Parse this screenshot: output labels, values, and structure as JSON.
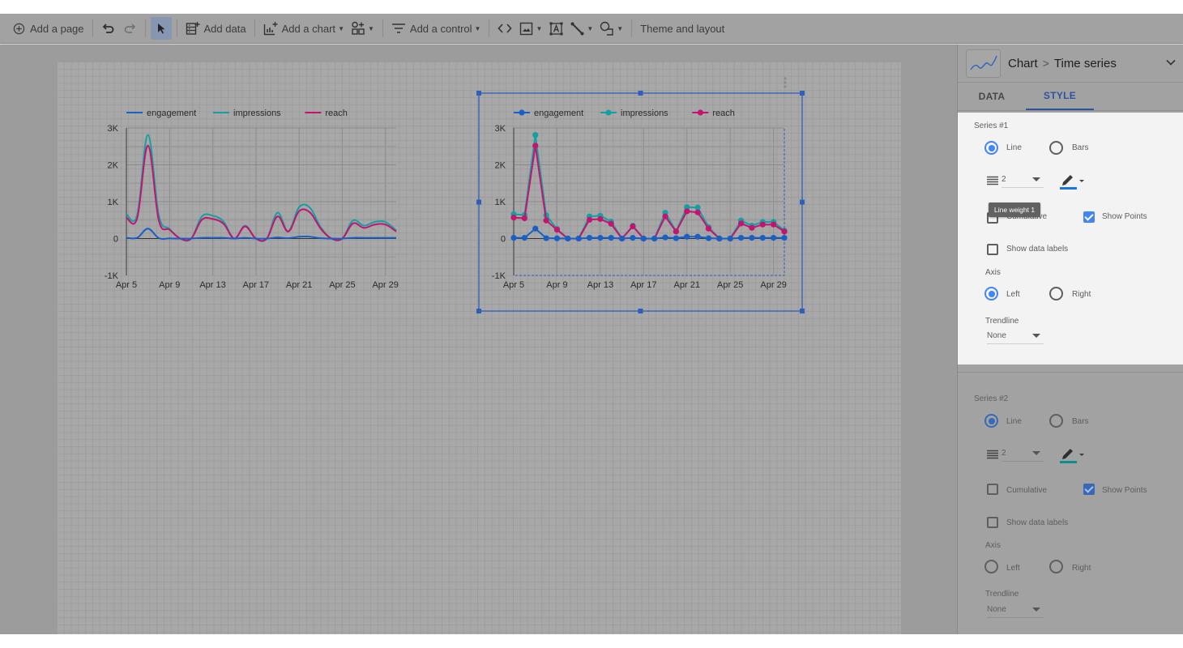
{
  "toolbar": {
    "add_page": "Add a page",
    "add_data": "Add data",
    "add_chart": "Add a chart",
    "add_control": "Add a control",
    "theme_layout": "Theme and layout",
    "icons": [
      "add-circle-icon",
      "undo-icon",
      "redo-icon",
      "select-pointer-icon",
      "add-data-icon",
      "add-chart-icon",
      "add-component-icon",
      "filter-control-icon",
      "embed-code-icon",
      "image-icon",
      "text-box-icon",
      "line-icon",
      "shape-icon"
    ]
  },
  "panel": {
    "breadcrumb": {
      "root": "Chart",
      "separator": ">",
      "leaf": "Time series"
    },
    "tabs": [
      {
        "label": "DATA",
        "active": false
      },
      {
        "label": "STYLE",
        "active": true
      }
    ],
    "tooltip": "Line weight 1",
    "series": [
      {
        "title": "Series #1",
        "type_options": [
          {
            "label": "Line",
            "selected": true
          },
          {
            "label": "Bars",
            "selected": false
          }
        ],
        "line_weight": "2",
        "line_color": "#1a73e8",
        "cumulative_label": "Cumulative",
        "cumulative": false,
        "show_points_label": "Show Points",
        "show_points": true,
        "show_data_labels_label": "Show data labels",
        "show_data_labels": false,
        "axis_label": "Axis",
        "axis_options": [
          {
            "label": "Left",
            "selected": true
          },
          {
            "label": "Right",
            "selected": false
          }
        ],
        "trendline_label": "Trendline",
        "trendline": "None"
      },
      {
        "title": "Series #2",
        "type_options": [
          {
            "label": "Line",
            "selected": true
          },
          {
            "label": "Bars",
            "selected": false
          }
        ],
        "line_weight": "2",
        "line_color": "#12a4a4",
        "cumulative_label": "Cumulative",
        "cumulative": false,
        "show_points_label": "Show Points",
        "show_points": true,
        "show_data_labels_label": "Show data labels",
        "show_data_labels": false,
        "axis_label": "Axis",
        "axis_options": [
          {
            "label": "Left",
            "selected": false
          },
          {
            "label": "Right",
            "selected": false
          }
        ],
        "trendline_label": "Trendline",
        "trendline": "None"
      }
    ]
  },
  "chart_data": [
    {
      "type": "line",
      "style": "smooth",
      "show_points": false,
      "selected": false,
      "x": [
        "Apr 5",
        "Apr 6",
        "Apr 7",
        "Apr 8",
        "Apr 9",
        "Apr 10",
        "Apr 11",
        "Apr 12",
        "Apr 13",
        "Apr 14",
        "Apr 15",
        "Apr 16",
        "Apr 17",
        "Apr 18",
        "Apr 19",
        "Apr 20",
        "Apr 21",
        "Apr 22",
        "Apr 23",
        "Apr 24",
        "Apr 25",
        "Apr 26",
        "Apr 27",
        "Apr 28",
        "Apr 29",
        "Apr 30"
      ],
      "x_ticks": [
        "Apr 5",
        "Apr 9",
        "Apr 13",
        "Apr 17",
        "Apr 21",
        "Apr 25",
        "Apr 29"
      ],
      "y_ticks": [
        "3K",
        "2K",
        "1K",
        "0",
        "-1K"
      ],
      "ylim": [
        -1000,
        3000
      ],
      "legend": "top-left",
      "grid": true,
      "series": [
        {
          "name": "engagement",
          "color": "#1a5fc4",
          "values": [
            20,
            20,
            270,
            10,
            5,
            0,
            0,
            20,
            20,
            20,
            0,
            20,
            0,
            0,
            30,
            10,
            50,
            50,
            10,
            0,
            0,
            20,
            20,
            20,
            20,
            20
          ]
        },
        {
          "name": "impressions",
          "color": "#13a0a3",
          "values": [
            660,
            640,
            2810,
            630,
            260,
            0,
            0,
            600,
            620,
            460,
            0,
            350,
            0,
            0,
            700,
            200,
            850,
            840,
            310,
            0,
            0,
            490,
            350,
            450,
            450,
            220
          ]
        },
        {
          "name": "reach",
          "color": "#c41470",
          "values": [
            570,
            550,
            2520,
            490,
            240,
            0,
            0,
            510,
            530,
            400,
            0,
            330,
            0,
            0,
            600,
            190,
            740,
            710,
            270,
            0,
            0,
            410,
            290,
            380,
            380,
            190
          ]
        }
      ]
    },
    {
      "type": "line",
      "style": "straight",
      "show_points": true,
      "selected": true,
      "x": [
        "Apr 5",
        "Apr 6",
        "Apr 7",
        "Apr 8",
        "Apr 9",
        "Apr 10",
        "Apr 11",
        "Apr 12",
        "Apr 13",
        "Apr 14",
        "Apr 15",
        "Apr 16",
        "Apr 17",
        "Apr 18",
        "Apr 19",
        "Apr 20",
        "Apr 21",
        "Apr 22",
        "Apr 23",
        "Apr 24",
        "Apr 25",
        "Apr 26",
        "Apr 27",
        "Apr 28",
        "Apr 29",
        "Apr 30"
      ],
      "x_ticks": [
        "Apr 5",
        "Apr 9",
        "Apr 13",
        "Apr 17",
        "Apr 21",
        "Apr 25",
        "Apr 29"
      ],
      "y_ticks": [
        "3K",
        "2K",
        "1K",
        "0",
        "-1K"
      ],
      "ylim": [
        -1000,
        3000
      ],
      "legend": "top-left",
      "grid": true,
      "series": [
        {
          "name": "engagement",
          "color": "#1a5fc4",
          "values": [
            20,
            20,
            270,
            10,
            5,
            0,
            0,
            20,
            20,
            20,
            0,
            20,
            0,
            0,
            30,
            10,
            50,
            50,
            10,
            0,
            0,
            20,
            20,
            20,
            20,
            20
          ]
        },
        {
          "name": "impressions",
          "color": "#13a0a3",
          "values": [
            660,
            640,
            2810,
            630,
            260,
            0,
            0,
            600,
            620,
            460,
            0,
            350,
            0,
            0,
            700,
            200,
            850,
            840,
            310,
            0,
            0,
            490,
            350,
            450,
            450,
            220
          ]
        },
        {
          "name": "reach",
          "color": "#c41470",
          "values": [
            570,
            550,
            2520,
            490,
            240,
            0,
            0,
            510,
            530,
            400,
            0,
            330,
            0,
            0,
            600,
            190,
            740,
            710,
            270,
            0,
            0,
            410,
            290,
            380,
            380,
            190
          ]
        }
      ]
    }
  ]
}
